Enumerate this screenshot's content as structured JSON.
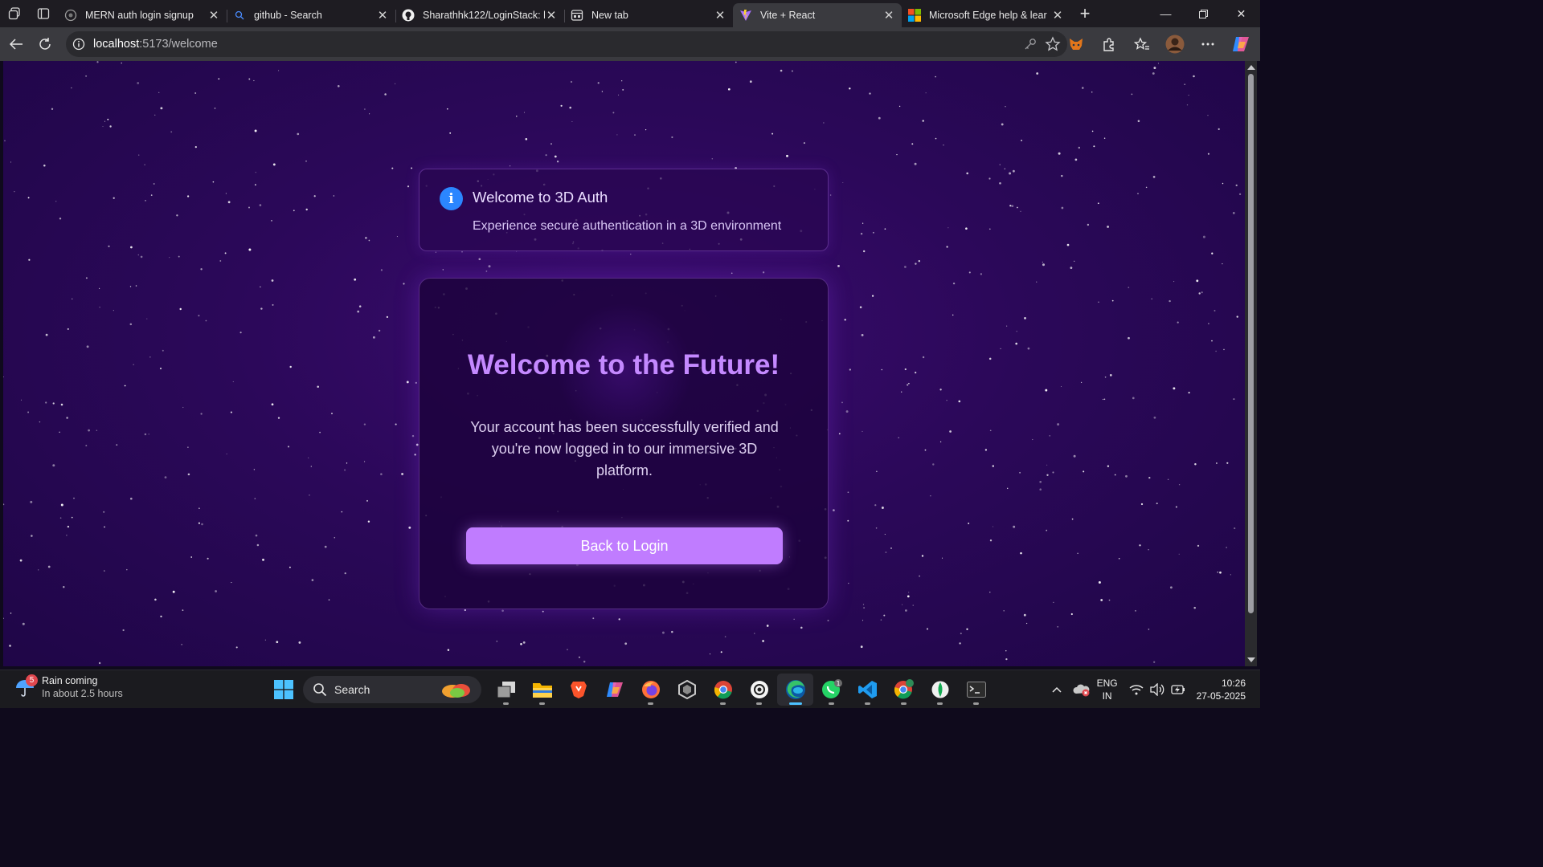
{
  "browser": {
    "tabs": [
      {
        "title": "MERN auth login signup",
        "icon": "globe-icon"
      },
      {
        "title": "github - Search",
        "icon": "search-icon"
      },
      {
        "title": "Sharathhk122/LoginStack: l",
        "icon": "github-icon"
      },
      {
        "title": "New tab",
        "icon": "newtab-icon"
      },
      {
        "title": "Vite + React",
        "icon": "vite-icon",
        "active": true
      },
      {
        "title": "Microsoft Edge help & lear",
        "icon": "microsoft-icon"
      }
    ],
    "url_host": "localhost",
    "url_rest": ":5173/welcome"
  },
  "page": {
    "info": {
      "title": "Welcome to 3D Auth",
      "description": "Experience secure authentication in a 3D environment"
    },
    "card": {
      "headline": "Welcome to the Future!",
      "body": "Your account has been successfully verified and you're now logged in to our immersive 3D platform.",
      "button": "Back to Login"
    },
    "colors": {
      "background": "#2b0859",
      "accent": "#c07cff",
      "headline": "#c489ff",
      "info_icon": "#2b86ff"
    }
  },
  "taskbar": {
    "weather": {
      "title": "Rain coming",
      "subtitle": "In about 2.5 hours",
      "badge": "5"
    },
    "search_label": "Search",
    "apps": [
      "task-view",
      "file-explorer",
      "brave",
      "copilot",
      "firefox",
      "unity",
      "chrome",
      "chatgpt",
      "edge",
      "whatsapp",
      "vscode",
      "chrome-profile",
      "mongodb-compass",
      "terminal"
    ],
    "whatsapp_badge": "1",
    "language": "ENG",
    "region": "IN",
    "time": "10:26",
    "date": "27-05-2025"
  }
}
